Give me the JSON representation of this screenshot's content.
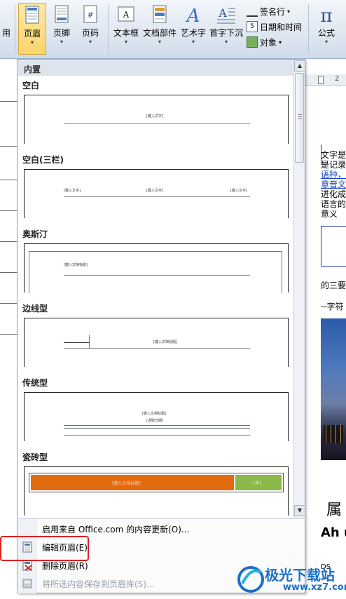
{
  "ribbon": {
    "left_label": "用",
    "header_label": "页眉",
    "footer_label": "页脚",
    "pagenum_label": "页码",
    "textbox_label": "文本框",
    "quickparts_label": "文档部件",
    "wordart_label": "艺术字",
    "dropcap_label": "首字下沉",
    "signature_label": "签名行",
    "datetime_label": "日期和时间",
    "object_label": "对象",
    "equation_label": "公式",
    "dropdown_arrow": "▾"
  },
  "popup": {
    "header": "内置",
    "sections": [
      {
        "title": "空白",
        "placeholders": [
          "[键入文字]"
        ]
      },
      {
        "title": "空白(三栏)",
        "placeholders": [
          "[键入文字]",
          "[键入文字]",
          "[键入文字]"
        ]
      },
      {
        "title": "奥斯汀",
        "placeholders": [
          "[键入文档标题]"
        ]
      },
      {
        "title": "边线型",
        "placeholders": [
          "[键入文档标题]"
        ]
      },
      {
        "title": "传统型",
        "placeholders": [
          "[键入文档标题]",
          "[选取日期]"
        ]
      },
      {
        "title": "瓷砖型",
        "placeholders": [
          "[键入文档标题]",
          "[年]"
        ]
      }
    ],
    "menu": [
      {
        "label": "启用来自 Office.com 的内容更新(O)...",
        "enabled": true
      },
      {
        "label": "编辑页眉(E)",
        "enabled": true
      },
      {
        "label": "删除页眉(R)",
        "enabled": true
      },
      {
        "label": "将所选内容保存到页眉库(S)...",
        "enabled": false
      }
    ]
  },
  "document": {
    "lines": [
      "文字是",
      "是记录",
      "语种，",
      "意音文",
      "进化成",
      "语言的",
      "意义"
    ],
    "line_links": [
      false,
      false,
      true,
      true,
      false,
      false,
      false
    ],
    "para2": "的三要",
    "para3": "--字符",
    "heading_big": "属",
    "heading_sub": "Ah u",
    "footer_snippet": "DS",
    "ruler_num": "2"
  },
  "watermark": {
    "text": "极光下载站",
    "url": "www.xz7.com"
  },
  "colors": {
    "accent_red": "#e02020",
    "tile_orange": "#e26b10",
    "tile_green": "#8cb84a",
    "link_blue": "#1a47c4"
  }
}
